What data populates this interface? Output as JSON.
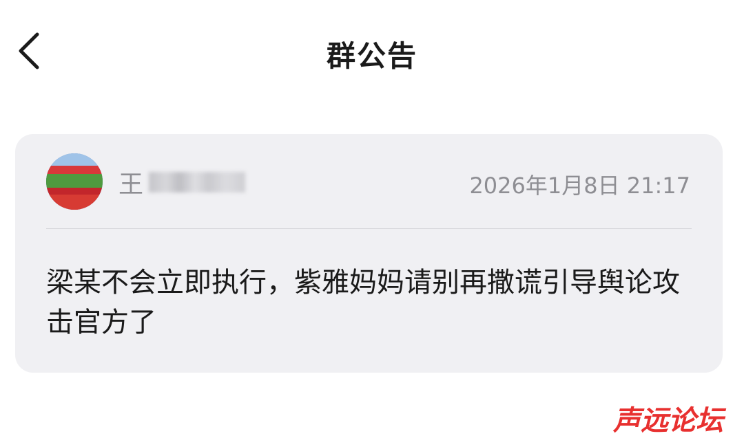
{
  "header": {
    "title": "群公告",
    "back_icon": "chevron-left-icon"
  },
  "announcement": {
    "author_name_visible": "王",
    "timestamp": "2026年1月8日 21:17",
    "content": "梁某不会立即执行，紫雅妈妈请别再撒谎引导舆论攻击官方了"
  },
  "watermark": {
    "text": "声远论坛",
    "color": "#e8302f"
  }
}
